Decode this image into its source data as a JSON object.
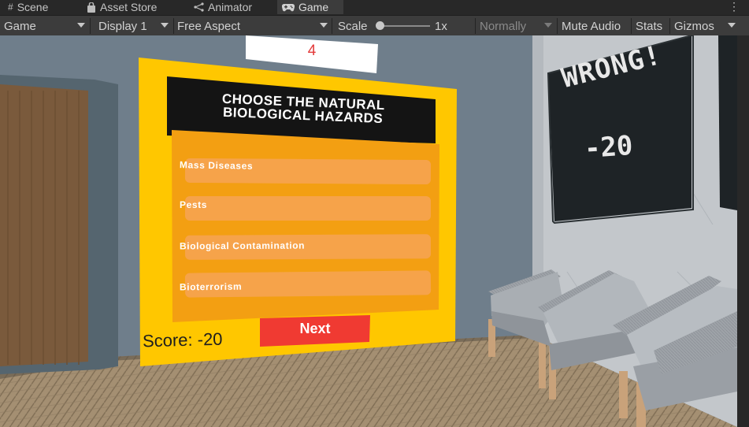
{
  "editor": {
    "tabs": [
      {
        "label": "Scene",
        "icon": "grid-icon",
        "active": false
      },
      {
        "label": "Asset Store",
        "icon": "bag-icon",
        "active": false
      },
      {
        "label": "Animator",
        "icon": "animator-icon",
        "active": false
      },
      {
        "label": "Game",
        "icon": "gamepad-icon",
        "active": true
      }
    ],
    "more_glyph": "⋮",
    "toolbar": {
      "view_mode": "Game",
      "display": "Display 1",
      "aspect": "Free Aspect",
      "scale_label": "Scale",
      "scale_value": "1x",
      "play_mode": "Normally",
      "mute_audio": "Mute Audio",
      "stats": "Stats",
      "gizmos": "Gizmos"
    }
  },
  "game": {
    "counter": "4",
    "question": {
      "line1": "CHOOSE THE NATURAL",
      "line2": "BIOLOGICAL  HAZARDS"
    },
    "options": [
      "Mass Diseases",
      "Pests",
      "Biological Contamination",
      "Bioterrorism"
    ],
    "score": "Score: -20",
    "next_label": "Next",
    "feedback": {
      "result": "WRONG!",
      "points": "-20"
    }
  },
  "colors": {
    "panel_yellow": "#ffc700",
    "option_orange": "#f6a030",
    "next_red": "#f03a32",
    "counter_red": "#e33b3b",
    "board_dark": "#1e2326"
  }
}
